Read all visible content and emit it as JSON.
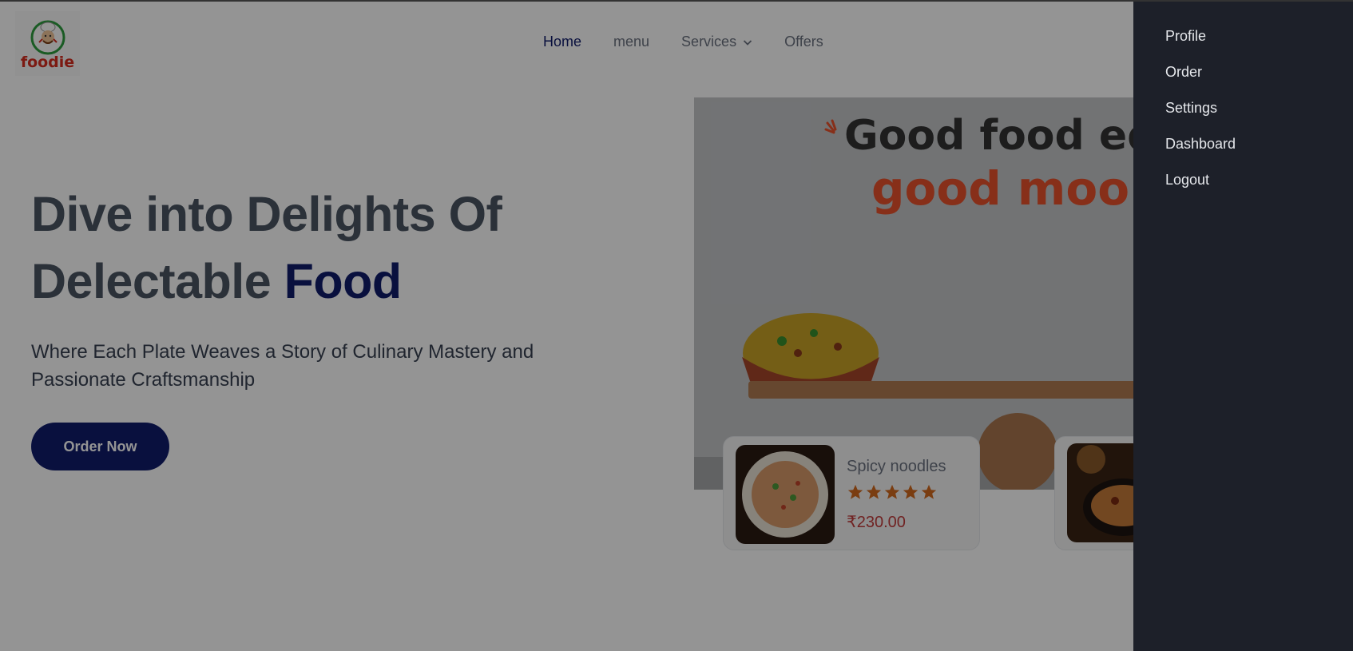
{
  "brand": {
    "logo_text": "foodie"
  },
  "nav": {
    "items": [
      {
        "label": "Home",
        "active": true
      },
      {
        "label": "menu",
        "active": false
      },
      {
        "label": "Services",
        "active": false,
        "has_dropdown": true
      },
      {
        "label": "Offers",
        "active": false
      }
    ]
  },
  "hero": {
    "title_part1": "Dive into Delights Of",
    "title_part2": "Delectable",
    "title_accent": "Food",
    "subtitle": "Where Each Plate Weaves a Story of Culinary Mastery and Passionate Craftsmanship",
    "cta_label": "Order Now"
  },
  "banner": {
    "line1": "Good food equ",
    "line2": "good moo"
  },
  "food_cards": [
    {
      "name": "Spicy noodles",
      "rating": 5,
      "price": "₹230.00"
    }
  ],
  "drawer": {
    "items": [
      "Profile",
      "Order",
      "Settings",
      "Dashboard",
      "Logout"
    ]
  },
  "colors": {
    "primary": "#101c6c",
    "drawer_bg": "#1d2029",
    "price": "#c23b3b",
    "star": "#d2691e",
    "banner_accent": "#e8522c"
  }
}
